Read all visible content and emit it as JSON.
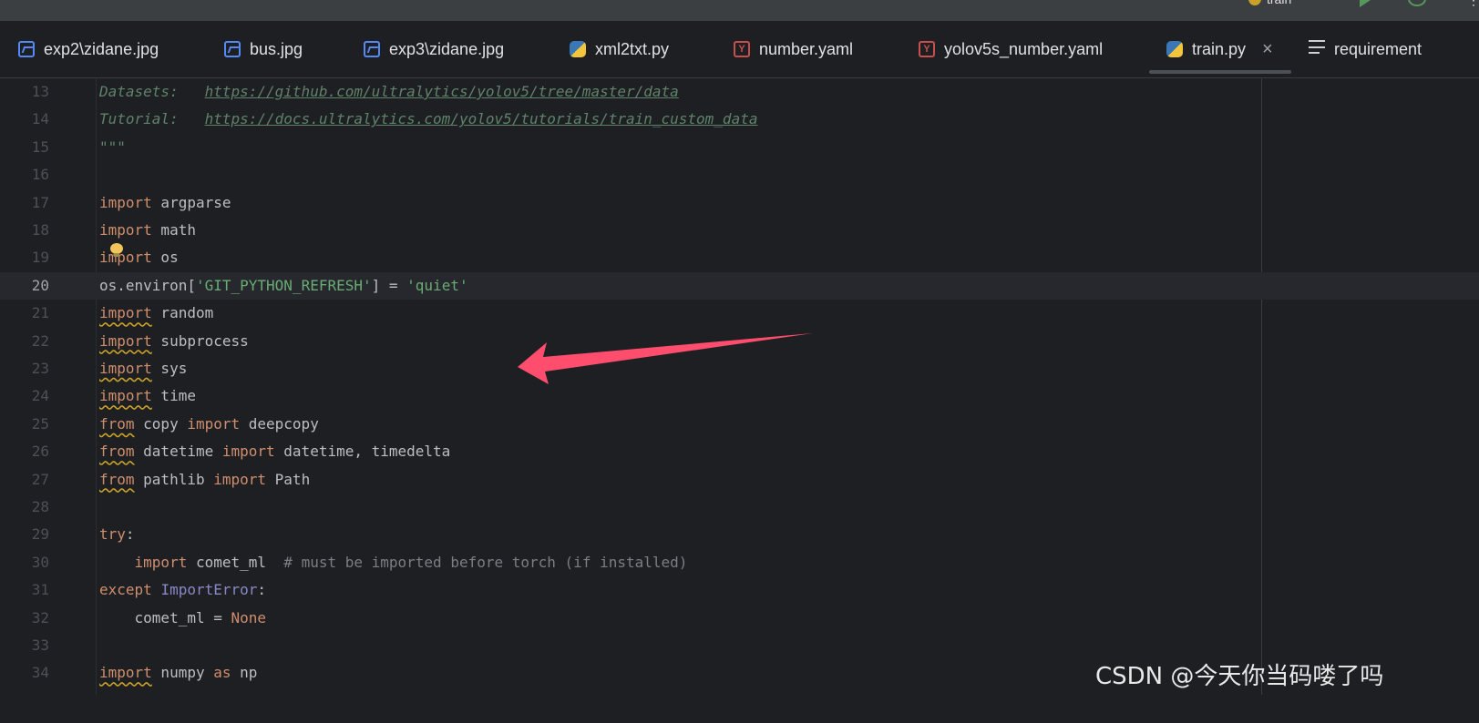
{
  "topbar": {
    "run_config_label": "train",
    "icons": [
      "run-config-icon",
      "run-icon",
      "debug-icon",
      "more-icon"
    ],
    "more_glyph": "⋮"
  },
  "tabs": [
    {
      "label": "exp2\\zidane.jpg",
      "icon": "image-file-icon"
    },
    {
      "label": "bus.jpg",
      "icon": "image-file-icon"
    },
    {
      "label": "exp3\\zidane.jpg",
      "icon": "image-file-icon"
    },
    {
      "label": "xml2txt.py",
      "icon": "python-file-icon"
    },
    {
      "label": "number.yaml",
      "icon": "yaml-file-icon"
    },
    {
      "label": "yolov5s_number.yaml",
      "icon": "yaml-file-icon"
    },
    {
      "label": "train.py",
      "icon": "python-file-icon",
      "active": true
    },
    {
      "label": "requirement",
      "icon": "text-file-icon"
    }
  ],
  "tab_close_glyph": "×",
  "yaml_icon_glyph": "Y",
  "editor": {
    "current_line": 20,
    "lines": [
      {
        "n": "13",
        "tokens": [
          [
            "doc",
            "Datasets:   "
          ],
          [
            "url",
            "https://github.com/ultralytics/yolov5/tree/master/data"
          ]
        ]
      },
      {
        "n": "14",
        "tokens": [
          [
            "doc",
            "Tutorial:   "
          ],
          [
            "url",
            "https://docs.ultralytics.com/yolov5/tutorials/train_custom_data"
          ]
        ]
      },
      {
        "n": "15",
        "tokens": [
          [
            "doc",
            "\"\"\""
          ]
        ]
      },
      {
        "n": "16",
        "tokens": []
      },
      {
        "n": "17",
        "tokens": [
          [
            "kw",
            "import"
          ],
          [
            "t",
            " argparse"
          ]
        ]
      },
      {
        "n": "18",
        "tokens": [
          [
            "kw",
            "import"
          ],
          [
            "t",
            " math"
          ]
        ]
      },
      {
        "n": "19",
        "tokens": [
          [
            "kw",
            "import"
          ],
          [
            "t",
            " os"
          ]
        ]
      },
      {
        "n": "20",
        "tokens": [
          [
            "t",
            "os.environ["
          ],
          [
            "str",
            "'GIT_PYTHON_REFRESH'"
          ],
          [
            "t",
            "] = "
          ],
          [
            "str",
            "'quiet'"
          ]
        ]
      },
      {
        "n": "21",
        "tokens": [
          [
            "kwwarn",
            "import"
          ],
          [
            "t",
            " random"
          ]
        ]
      },
      {
        "n": "22",
        "tokens": [
          [
            "kwwarn",
            "import"
          ],
          [
            "t",
            " subprocess"
          ]
        ]
      },
      {
        "n": "23",
        "tokens": [
          [
            "kwwarn",
            "import"
          ],
          [
            "t",
            " sys"
          ]
        ]
      },
      {
        "n": "24",
        "tokens": [
          [
            "kwwarn",
            "import"
          ],
          [
            "t",
            " time"
          ]
        ]
      },
      {
        "n": "25",
        "tokens": [
          [
            "kwwarn",
            "from"
          ],
          [
            "t",
            " copy "
          ],
          [
            "kw",
            "import"
          ],
          [
            "t",
            " deepcopy"
          ]
        ]
      },
      {
        "n": "26",
        "tokens": [
          [
            "kwwarn",
            "from"
          ],
          [
            "t",
            " datetime "
          ],
          [
            "kw",
            "import"
          ],
          [
            "t",
            " datetime, timedelta"
          ]
        ]
      },
      {
        "n": "27",
        "tokens": [
          [
            "kwwarn",
            "from"
          ],
          [
            "t",
            " pathlib "
          ],
          [
            "kw",
            "import"
          ],
          [
            "t",
            " Path"
          ]
        ]
      },
      {
        "n": "28",
        "tokens": []
      },
      {
        "n": "29",
        "tokens": [
          [
            "kw",
            "try"
          ],
          [
            "t",
            ":"
          ]
        ]
      },
      {
        "n": "30",
        "tokens": [
          [
            "t",
            "    "
          ],
          [
            "kw",
            "import"
          ],
          [
            "t",
            " comet_ml  "
          ],
          [
            "cmt",
            "# must be imported before torch (if installed)"
          ]
        ]
      },
      {
        "n": "31",
        "tokens": [
          [
            "kw",
            "except"
          ],
          [
            "t",
            " "
          ],
          [
            "cls",
            "ImportError"
          ],
          [
            "t",
            ":"
          ]
        ]
      },
      {
        "n": "32",
        "tokens": [
          [
            "t",
            "    comet_ml = "
          ],
          [
            "kw",
            "None"
          ]
        ]
      },
      {
        "n": "33",
        "tokens": []
      },
      {
        "n": "34",
        "tokens": [
          [
            "kwwarn",
            "import"
          ],
          [
            "t",
            " numpy "
          ],
          [
            "kw",
            "as"
          ],
          [
            "t",
            " np"
          ]
        ]
      }
    ]
  },
  "colors": {
    "annotation_arrow": "#ff4d6d",
    "keyword": "#cf8e6d",
    "string": "#6aab73"
  },
  "watermark": "CSDN @今天你当码喽了吗"
}
